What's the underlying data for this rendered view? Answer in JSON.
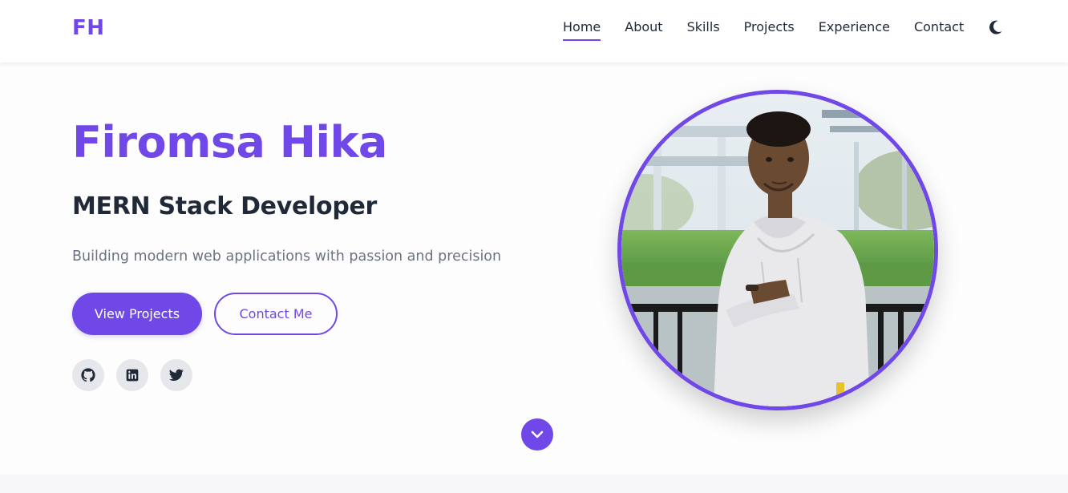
{
  "colors": {
    "accent": "#7048e8",
    "text_dark": "#1f2937",
    "text_muted": "#6b7280",
    "social_bg": "#e5e7eb"
  },
  "navbar": {
    "logo": "FH",
    "links": [
      {
        "label": "Home",
        "active": true
      },
      {
        "label": "About",
        "active": false
      },
      {
        "label": "Skills",
        "active": false
      },
      {
        "label": "Projects",
        "active": false
      },
      {
        "label": "Experience",
        "active": false
      },
      {
        "label": "Contact",
        "active": false
      }
    ],
    "theme_toggle_icon": "moon-icon"
  },
  "hero": {
    "name": "Firomsa Hika",
    "role": "MERN Stack Developer",
    "tagline": "Building modern web applications with passion and precision",
    "primary_button": "View Projects",
    "secondary_button": "Contact Me",
    "socials": [
      {
        "icon": "github-icon"
      },
      {
        "icon": "linkedin-icon"
      },
      {
        "icon": "twitter-icon"
      }
    ],
    "scroll_icon": "chevron-down-icon",
    "profile_image": "profile-photo"
  }
}
